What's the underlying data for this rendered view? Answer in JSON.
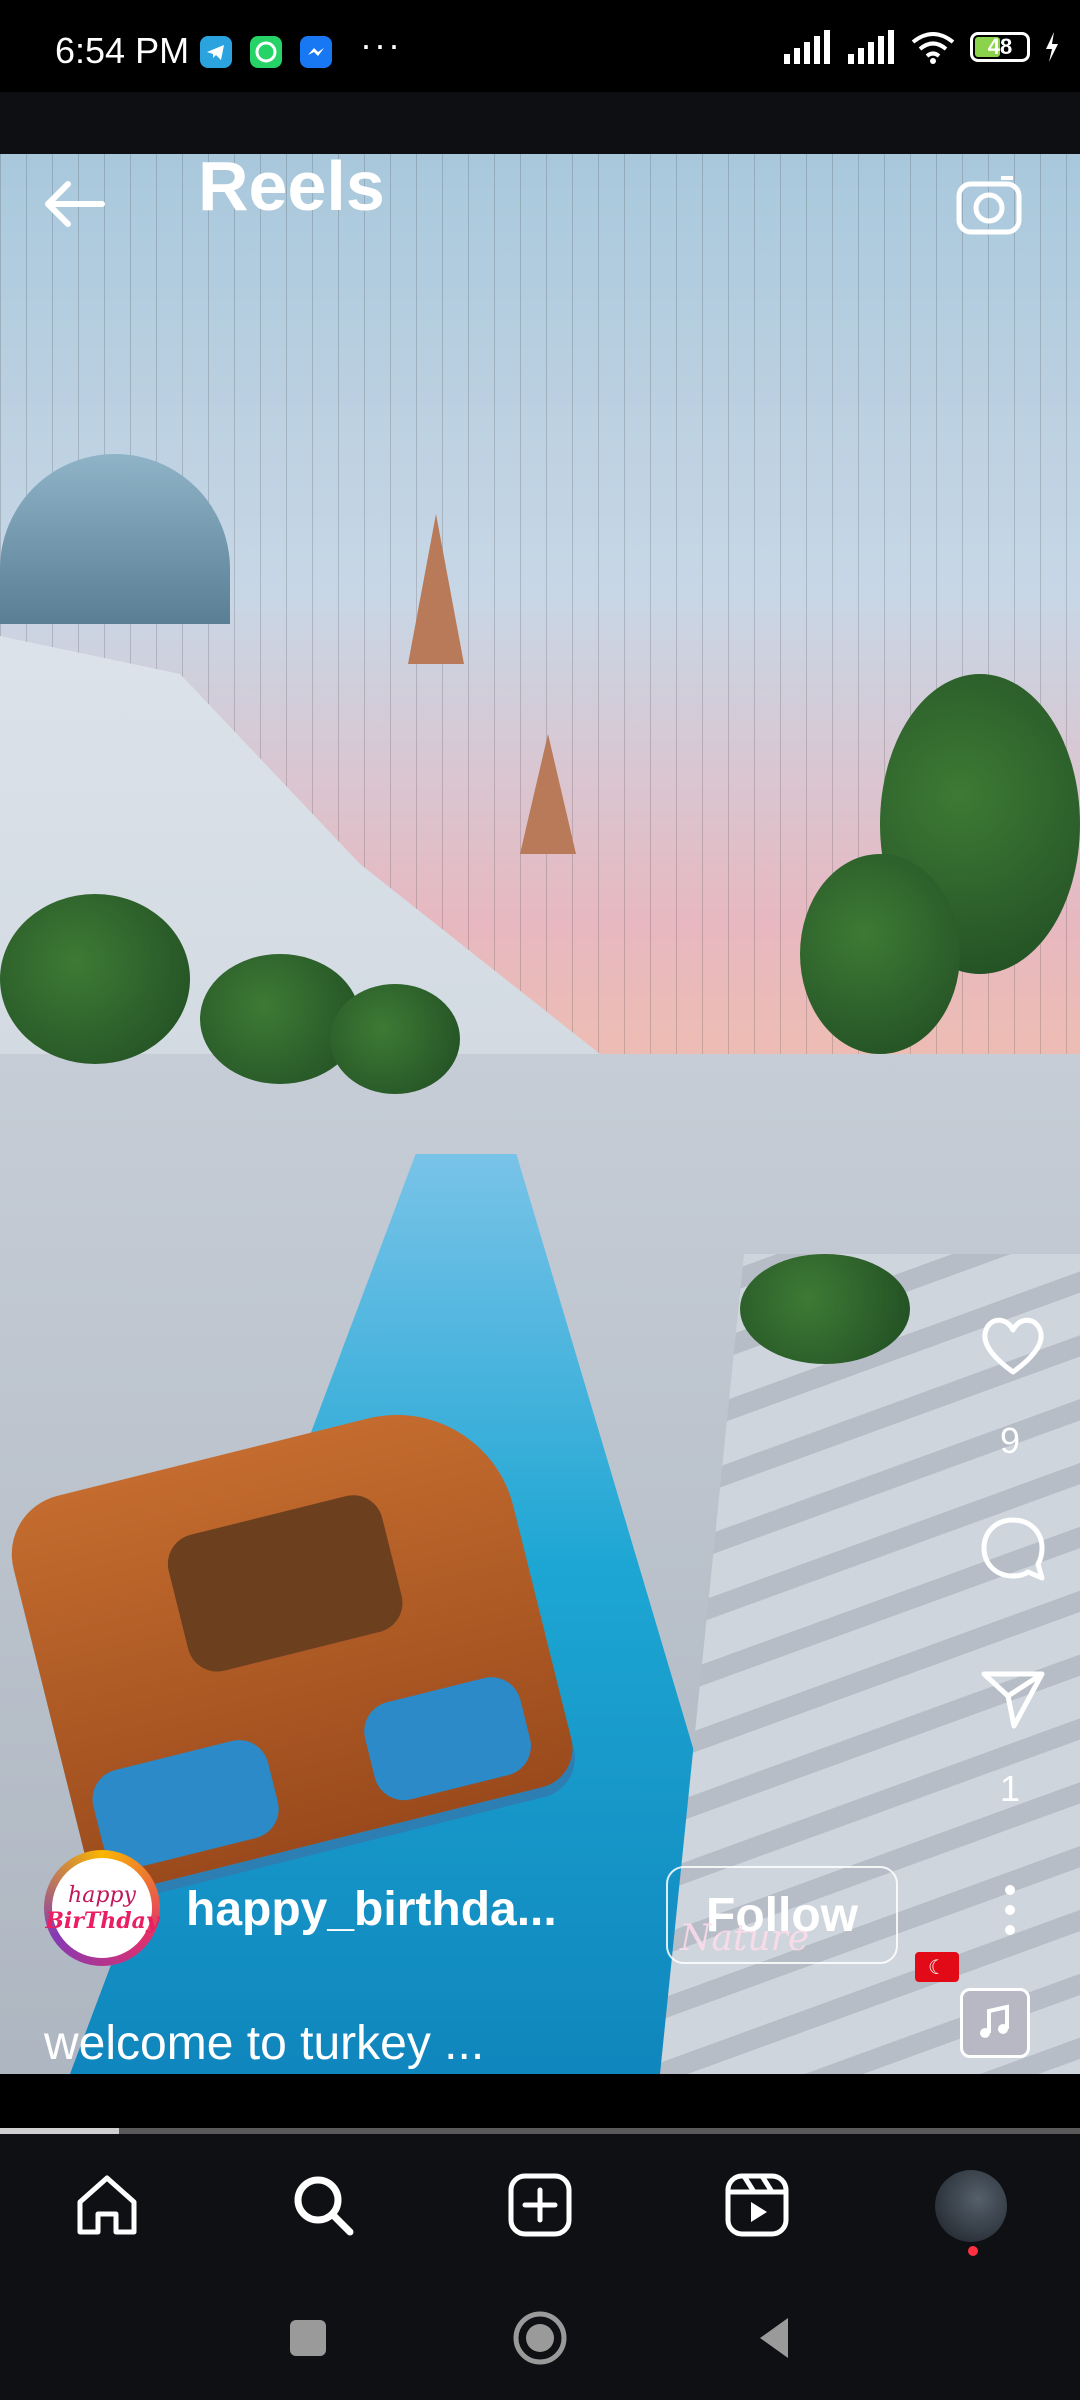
{
  "status_bar": {
    "time": "6:54 PM",
    "more": "···",
    "battery": "48",
    "battery_level": 0.48,
    "apps": [
      "telegram-icon",
      "whatsapp-icon",
      "messenger-icon"
    ]
  },
  "header": {
    "title": "Reels"
  },
  "reel": {
    "username": "happy_birthda...",
    "follow_label": "Follow",
    "caption": "welcome to turkey ...",
    "avatar_text_line1": "happy",
    "avatar_text_line2": "BirThday",
    "watermark": "Nature",
    "progress": 0.11
  },
  "actions": {
    "likes": "9",
    "shares": "1"
  },
  "bottom_nav": {
    "items": [
      "home-icon",
      "search-icon",
      "create-icon",
      "reels-icon",
      "profile-avatar"
    ]
  },
  "colors": {
    "background": "#000000",
    "nav_background": "#0e1013",
    "notification_dot": "#ff3040",
    "battery_fill": "#8bd34a"
  }
}
